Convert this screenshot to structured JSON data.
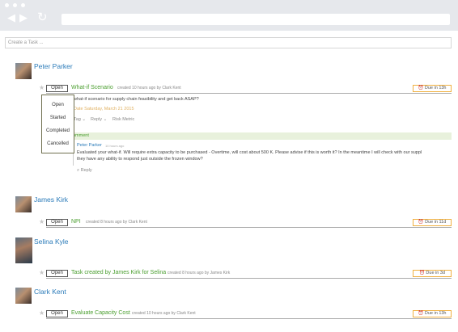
{
  "browser": {
    "back": "◀",
    "forward": "▶",
    "reload": "↻"
  },
  "create_task": {
    "placeholder": "Create a Task ..."
  },
  "users": [
    {
      "name": "Peter Parker"
    },
    {
      "name": "James Kirk"
    },
    {
      "name": "Selina Kyle"
    },
    {
      "name": "Clark Kent"
    }
  ],
  "tasks": [
    {
      "status": "Open",
      "title": "What-if Scenario",
      "meta": "created 10 hours ago by Clark Kent",
      "due": "Due in 13h"
    },
    {
      "status": "Open",
      "title": "NPI",
      "meta": "created 8 hours ago by Clark Kent",
      "due": "Due in 11d"
    },
    {
      "status": "Open",
      "title": "Task created by James Kirk for Selina",
      "meta": "created 8 hours ago by James Kirk",
      "due": "Due in 3d"
    },
    {
      "status": "Open",
      "title": "Evaluate Capacity Cost",
      "meta": "created 10 hours ago by Clark Kent",
      "due": "Due in 13h"
    }
  ],
  "status_dropdown": [
    "Open",
    "Started",
    "Completed",
    "Cancelled"
  ],
  "detail": {
    "description": "what-if scenario for supply chain feasibility and get back ASAP?",
    "due_date": "Date Saturday, March 21 2015",
    "actions": [
      "Tag",
      "Reply",
      "Risk Metric"
    ],
    "comment_header": "omment",
    "comment_author": "Peter Parker",
    "comment_time": "10 hours ago",
    "comment_text_1": "Evaluated your what-if. Will require extra capacity to be purchased - Overtime, will cost about 500 K. Please advise if this is worth it? In the meantime I will check with our suppl",
    "comment_text_2": "they have any ability to respond just outside the frozen window?",
    "reply": "Reply"
  },
  "colors": {
    "link": "#2b7bb9",
    "task_title": "#4a9e2f",
    "due_border": "#f0b040"
  }
}
